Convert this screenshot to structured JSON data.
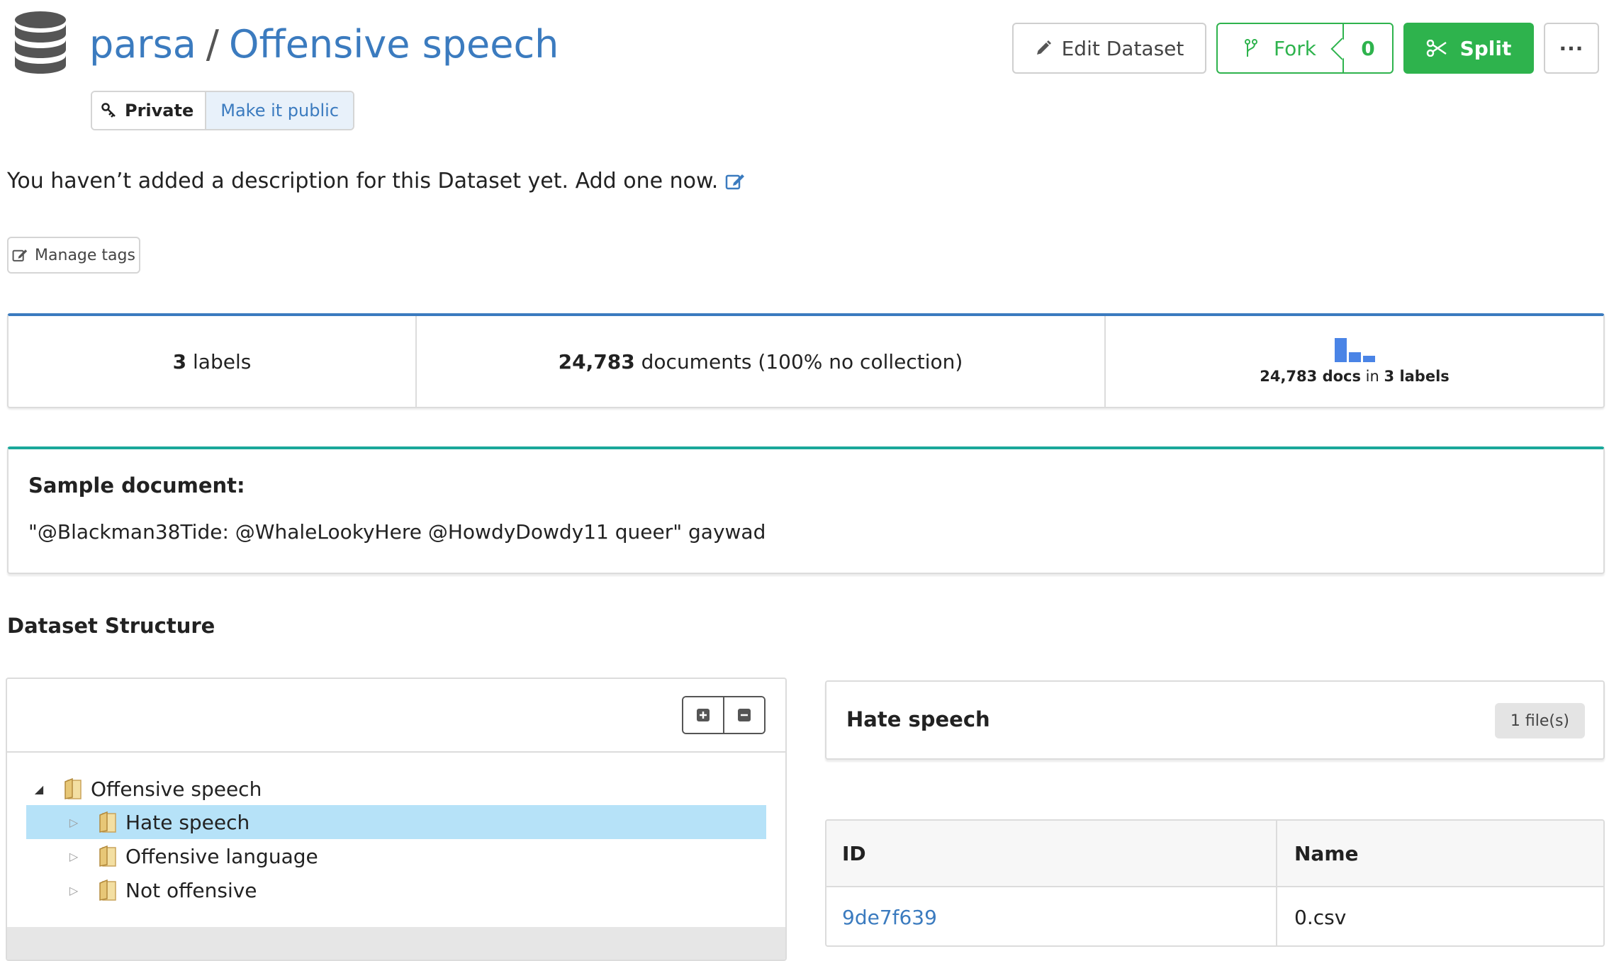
{
  "header": {
    "owner": "parsa",
    "separator": "/",
    "dataset_name": "Offensive speech",
    "privacy": {
      "status": "Private",
      "make_public": "Make it public"
    },
    "buttons": {
      "edit": "Edit Dataset",
      "fork": "Fork",
      "fork_count": "0",
      "split": "Split",
      "more": "···"
    }
  },
  "description": {
    "text": "You haven’t added a description for this Dataset yet. Add one now."
  },
  "tags": {
    "manage_label": "Manage tags"
  },
  "stats": {
    "labels_count": "3",
    "labels_word": "labels",
    "documents_count": "24,783",
    "documents_text": "documents (100% no collection)",
    "chart_docs": "24,783 docs",
    "chart_in": "in",
    "chart_labels": "3 labels"
  },
  "chart_data": {
    "type": "bar",
    "categories": [
      "Hate speech",
      "Offensive language",
      "Not offensive"
    ],
    "values": [
      100,
      40,
      25
    ],
    "title": "",
    "xlabel": "",
    "ylabel": ""
  },
  "sample": {
    "heading": "Sample document:",
    "text": "\"@Blackman38Tide: @WhaleLookyHere @HowdyDowdy11 queer\" gaywad"
  },
  "structure": {
    "title": "Dataset Structure",
    "tree": {
      "root": "Offensive speech",
      "children": [
        "Hate speech",
        "Offensive language",
        "Not offensive"
      ],
      "selected": "Hate speech"
    }
  },
  "selected_label": {
    "name": "Hate speech",
    "files_badge": "1 file(s)"
  },
  "files": {
    "columns": [
      "ID",
      "Name"
    ],
    "rows": [
      {
        "id": "9de7f639",
        "name": "0.csv"
      }
    ]
  },
  "colors": {
    "accent_blue": "#3b7bbf",
    "green": "#2eb34d",
    "teal": "#1aa89a",
    "selected_row": "#b6e2f8"
  }
}
